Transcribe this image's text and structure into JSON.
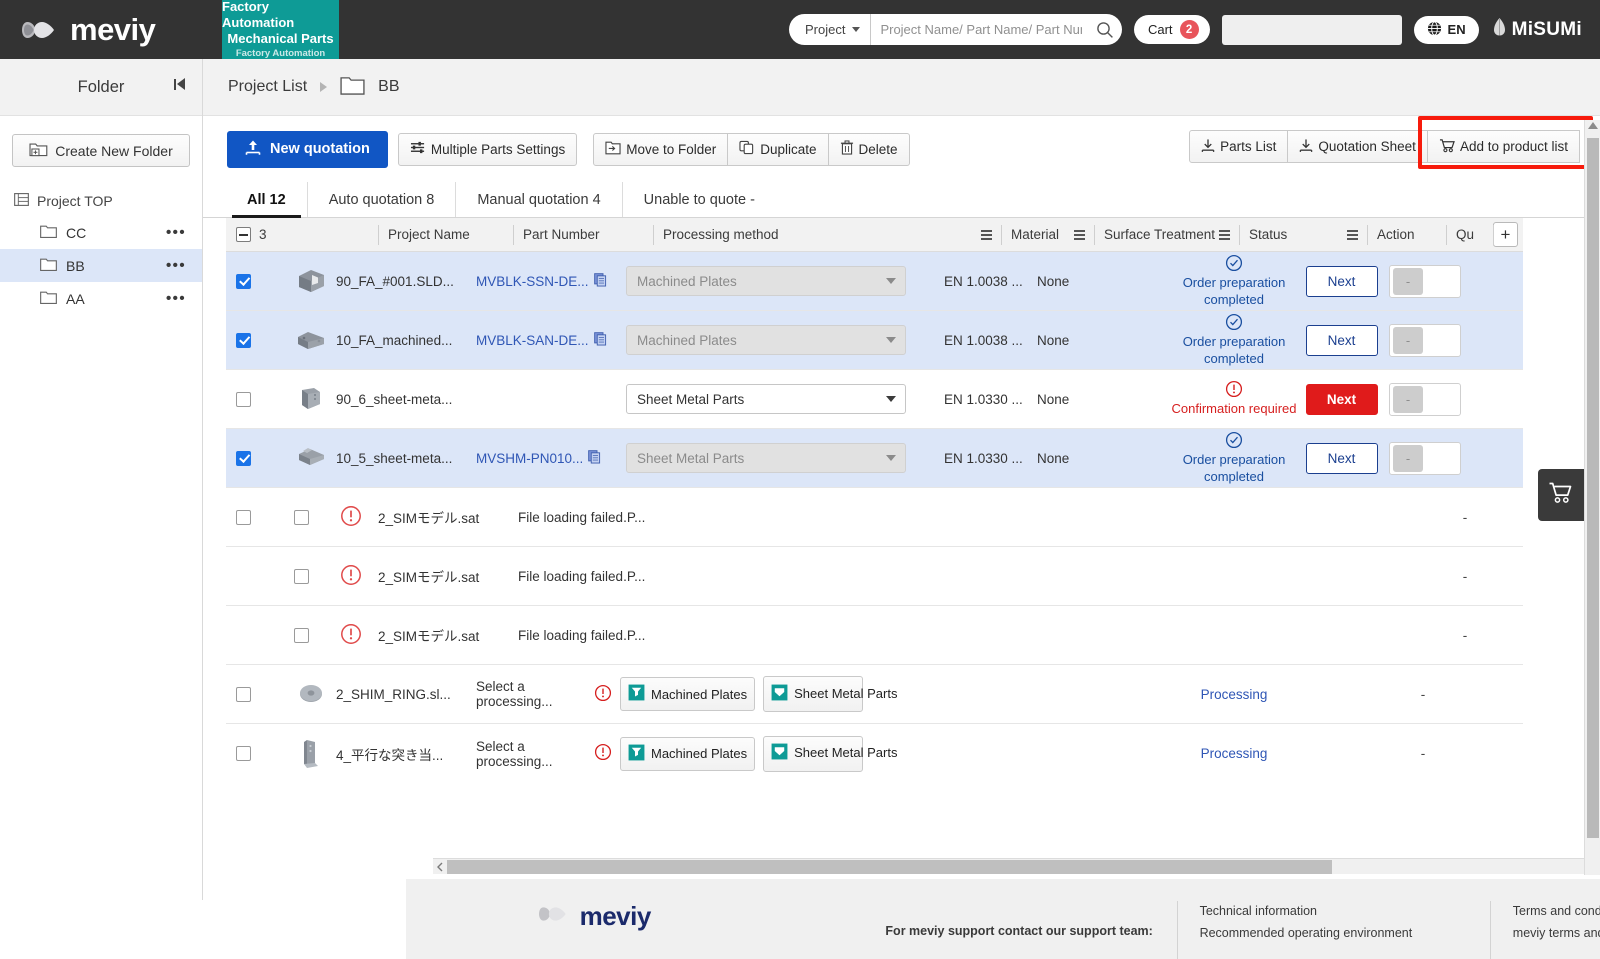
{
  "header": {
    "brand": "meviy",
    "category": {
      "line1": "Factory Automation",
      "line2": "Mechanical Parts",
      "line3": "Factory Automation"
    },
    "search": {
      "scope": "Project",
      "placeholder": "Project Name/ Part Name/ Part Number",
      "value": ""
    },
    "cart": {
      "label": "Cart",
      "count": "2"
    },
    "language": "EN",
    "corporate": "MiSUMi"
  },
  "sidebar": {
    "title": "Folder",
    "create_folder": "Create New Folder",
    "root": "Project TOP",
    "items": [
      {
        "label": "CC",
        "selected": false
      },
      {
        "label": "BB",
        "selected": true
      },
      {
        "label": "AA",
        "selected": false
      }
    ],
    "more_menu": "•••"
  },
  "breadcrumb": {
    "root": "Project List",
    "current": "BB"
  },
  "toolbar": {
    "new_quotation": "New quotation",
    "multiple_parts_settings": "Multiple Parts Settings",
    "move_to_folder": "Move to Folder",
    "duplicate": "Duplicate",
    "delete": "Delete",
    "parts_list": "Parts List",
    "quotation_sheet": "Quotation Sheet",
    "add_to_product_list": "Add to product list"
  },
  "tabs": [
    {
      "label": "All 12",
      "active": true
    },
    {
      "label": "Auto quotation 8",
      "active": false
    },
    {
      "label": "Manual quotation 4",
      "active": false
    },
    {
      "label": "Unable to quote -",
      "active": false
    }
  ],
  "table": {
    "selected_count": "3",
    "columns": {
      "project_name": "Project Name",
      "part_number": "Part Number",
      "processing_method": "Processing method",
      "material": "Material",
      "surface_treatment": "Surface Treatment",
      "status": "Status",
      "action": "Action",
      "quantity": "Qu",
      "add_column": "+"
    },
    "rows": [
      {
        "checked": true,
        "selected": true,
        "thumb": "machined-block",
        "project_name": "90_FA_#001.SLD...",
        "part_number": "MVBLK-SSN-DE...",
        "has_copy": true,
        "processing_method": "Machined Plates",
        "processing_disabled": true,
        "material": "EN 1.0038 ...",
        "surface_treatment": "None",
        "status": "Order preparation completed",
        "status_type": "ok",
        "action": "Next",
        "action_type": "normal",
        "quantity": "-"
      },
      {
        "checked": true,
        "selected": true,
        "thumb": "machined-bracket",
        "project_name": "10_FA_machined...",
        "part_number": "MVBLK-SAN-DE...",
        "has_copy": true,
        "processing_method": "Machined Plates",
        "processing_disabled": true,
        "material": "EN 1.0038 ...",
        "surface_treatment": "None",
        "status": "Order preparation completed",
        "status_type": "ok",
        "action": "Next",
        "action_type": "normal",
        "quantity": "-"
      },
      {
        "checked": false,
        "selected": false,
        "thumb": "sheet-fold",
        "project_name": "90_6_sheet-meta...",
        "part_number": "",
        "has_copy": false,
        "processing_method": "Sheet Metal Parts",
        "processing_disabled": false,
        "material": "EN 1.0330 ...",
        "surface_treatment": "None",
        "status": "Confirmation required",
        "status_type": "warn",
        "action": "Next",
        "action_type": "red",
        "quantity": "-"
      },
      {
        "checked": true,
        "selected": true,
        "thumb": "sheet-bend",
        "project_name": "10_5_sheet-meta...",
        "part_number": "MVSHM-PN010...",
        "has_copy": true,
        "processing_method": "Sheet Metal Parts",
        "processing_disabled": true,
        "material": "EN 1.0330 ...",
        "surface_treatment": "None",
        "status": "Order preparation completed",
        "status_type": "ok",
        "action": "Next",
        "action_type": "normal",
        "quantity": "-"
      },
      {
        "checked": false,
        "selected": false,
        "thumb": "error",
        "second_checkbox": true,
        "project_name": "2_SIMモデル.sat",
        "part_number": "File loading failed.P...",
        "has_copy": false,
        "processing_method": "",
        "material": "",
        "surface_treatment": "",
        "status": "",
        "status_type": "none",
        "action": "",
        "action_type": "none",
        "quantity": "-"
      },
      {
        "checked": false,
        "selected": false,
        "thumb": "error",
        "second_checkbox": true,
        "hide_first_checkbox": true,
        "project_name": "2_SIMモデル.sat",
        "part_number": "File loading failed.P...",
        "has_copy": false,
        "processing_method": "",
        "material": "",
        "surface_treatment": "",
        "status": "",
        "status_type": "none",
        "action": "",
        "action_type": "none",
        "quantity": "-"
      },
      {
        "checked": false,
        "selected": false,
        "thumb": "error",
        "second_checkbox": true,
        "hide_first_checkbox": true,
        "project_name": "2_SIMモデル.sat",
        "part_number": "File loading failed.P...",
        "has_copy": false,
        "processing_method": "",
        "material": "",
        "surface_treatment": "",
        "status": "",
        "status_type": "none",
        "action": "",
        "action_type": "none",
        "quantity": "-"
      },
      {
        "checked": false,
        "selected": false,
        "thumb": "ring",
        "project_name": "2_SHIM_RING.sl...",
        "part_number": "Select a processing...",
        "has_alert": true,
        "choice_a": "Machined Plates",
        "choice_b": "Sheet Metal Parts",
        "material": "",
        "surface_treatment": "",
        "status": "Processing",
        "status_type": "processing",
        "action": "",
        "action_type": "none",
        "quantity": "-"
      },
      {
        "checked": false,
        "selected": false,
        "thumb": "plate-tall",
        "project_name": "4_平行な突き当...",
        "part_number": "Select a processing...",
        "has_alert": true,
        "choice_a": "Machined Plates",
        "choice_b": "Sheet Metal Parts",
        "material": "",
        "surface_treatment": "",
        "status": "Processing",
        "status_type": "processing",
        "action": "",
        "action_type": "none",
        "quantity": "-"
      }
    ]
  },
  "footer": {
    "logo": "meviy",
    "support_text": "For meviy support contact our support team:",
    "col2": {
      "line1": "Technical information",
      "line2": "Recommended operating environment"
    },
    "col3": {
      "line1": "Terms and conditions",
      "line2": "meviy terms and conditions"
    }
  },
  "colors": {
    "accent_blue": "#1156c4",
    "teal": "#0e9b96",
    "alert_red": "#d61f1f",
    "highlight_red": "#f71b0c",
    "selected_row": "#dce6f8"
  }
}
